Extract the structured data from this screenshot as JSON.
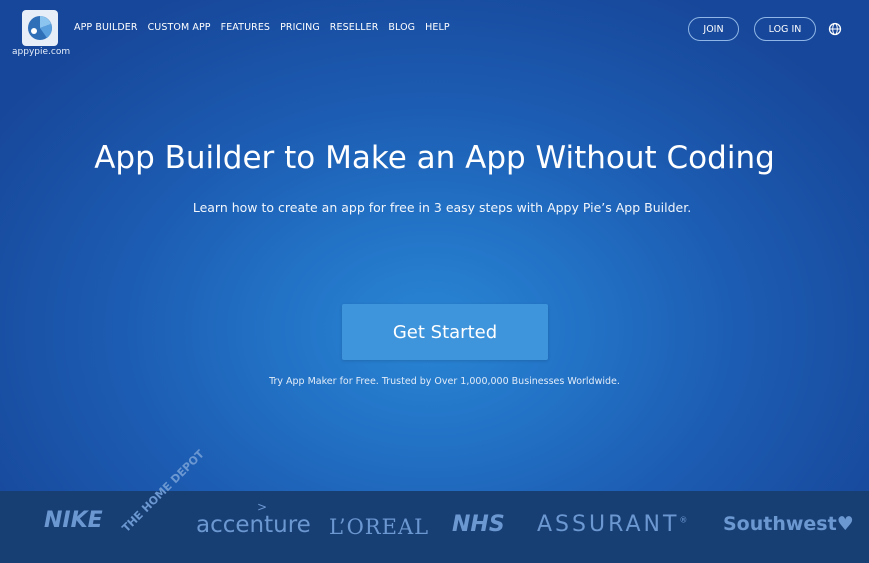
{
  "header": {
    "logo_text": "appypie.com",
    "nav": [
      "APP BUILDER",
      "CUSTOM APP",
      "FEATURES",
      "PRICING",
      "RESELLER",
      "BLOG",
      "HELP"
    ],
    "join_label": "JOIN",
    "login_label": "LOG IN",
    "globe_icon": "globe-icon"
  },
  "hero": {
    "title": "App Builder to Make an App Without Coding",
    "subtitle": "Learn how to create an app for free in 3 easy steps with Appy Pie’s App Builder.",
    "cta_label": "Get Started",
    "cta_note": "Try App Maker for Free. Trusted by Over 1,000,000 Businesses Worldwide."
  },
  "brands": {
    "nike": "NIKE",
    "homedepot": "THE HOME DEPOT",
    "accenture": "accenture",
    "accenture_mark": ">",
    "loreal": "L’OREAL",
    "nhs": "NHS",
    "assurant": "ASSURANT",
    "assurant_mark": "®",
    "southwest": "Southwest♥"
  },
  "colors": {
    "hero_center": "#2a86d4",
    "hero_edge": "#17479a",
    "cta": "#3f95dc",
    "band": "#183f74",
    "brand_logo": "#6c98d2"
  }
}
